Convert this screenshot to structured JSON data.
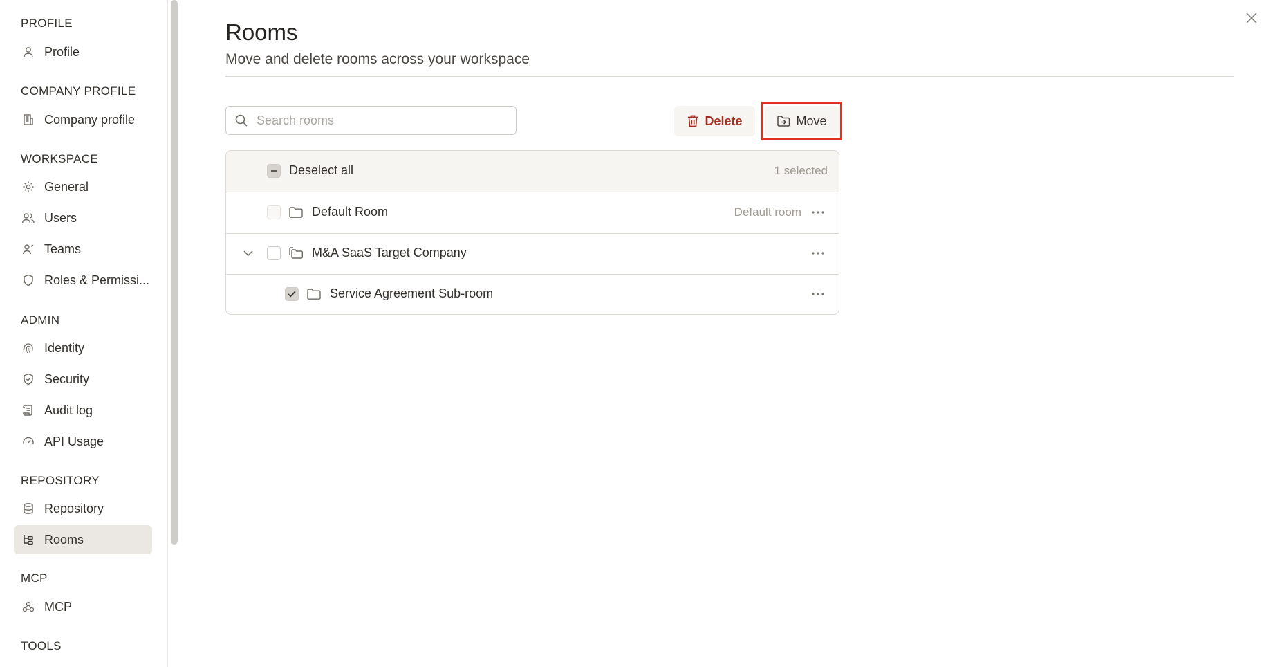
{
  "sidebar": {
    "sections": [
      {
        "title": "PROFILE"
      },
      {
        "title": "COMPANY PROFILE"
      },
      {
        "title": "WORKSPACE"
      },
      {
        "title": "ADMIN"
      },
      {
        "title": "REPOSITORY"
      },
      {
        "title": "MCP"
      },
      {
        "title": "TOOLS"
      }
    ],
    "items": {
      "profile": {
        "label": "Profile",
        "icon": "user-icon"
      },
      "company_profile": {
        "label": "Company profile",
        "icon": "building-icon"
      },
      "general": {
        "label": "General",
        "icon": "gear-icon"
      },
      "users": {
        "label": "Users",
        "icon": "users-icon"
      },
      "teams": {
        "label": "Teams",
        "icon": "team-icon"
      },
      "roles": {
        "label": "Roles & Permissi...",
        "icon": "shield-icon"
      },
      "identity": {
        "label": "Identity",
        "icon": "fingerprint-icon"
      },
      "security": {
        "label": "Security",
        "icon": "shield-check-icon"
      },
      "audit_log": {
        "label": "Audit log",
        "icon": "scroll-icon"
      },
      "api_usage": {
        "label": "API Usage",
        "icon": "gauge-icon"
      },
      "repository": {
        "label": "Repository",
        "icon": "database-icon"
      },
      "rooms": {
        "label": "Rooms",
        "icon": "tree-icon",
        "active": true
      },
      "mcp": {
        "label": "MCP",
        "icon": "network-icon"
      }
    }
  },
  "main": {
    "title": "Rooms",
    "subtitle": "Move and delete rooms across your workspace",
    "search": {
      "placeholder": "Search rooms",
      "value": ""
    },
    "actions": {
      "delete_label": "Delete",
      "move_label": "Move"
    },
    "table": {
      "header": {
        "deselect_label": "Deselect all",
        "selected_count": "1 selected"
      },
      "rows": [
        {
          "name": "Default Room",
          "meta": "Default room",
          "checked": false,
          "disabled": true,
          "level": 0,
          "icon": "folder-icon"
        },
        {
          "name": "M&A SaaS Target Company",
          "meta": "",
          "checked": false,
          "expanded": true,
          "level": 0,
          "icon": "folders-icon"
        },
        {
          "name": "Service Agreement Sub-room",
          "meta": "",
          "checked": true,
          "level": 1,
          "icon": "folder-icon"
        }
      ]
    }
  },
  "colors": {
    "accent_delete": "#a3311f",
    "highlight_frame": "#e0301e",
    "active_nav_bg": "#ebe8e4"
  }
}
